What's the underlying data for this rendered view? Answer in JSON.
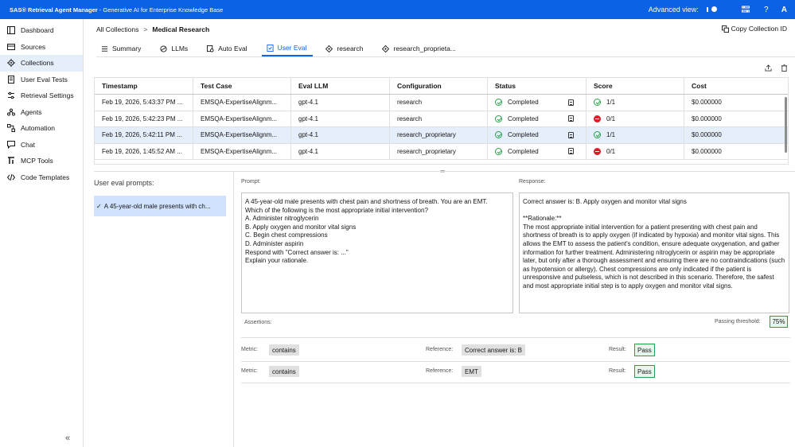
{
  "app": {
    "brand": "SAS® Retrieval Agent Manager",
    "subtitle": "- Generative AI for Enterprise Knowledge Base",
    "advanced_view_label": "Advanced view:",
    "avatar_initial": "A",
    "help_label": "?",
    "accent_color": "#0b62e4"
  },
  "sidebar": {
    "items": [
      {
        "label": "Dashboard",
        "icon": "dashboard-icon"
      },
      {
        "label": "Sources",
        "icon": "sources-icon"
      },
      {
        "label": "Collections",
        "icon": "collections-icon",
        "active": true
      },
      {
        "label": "User Eval Tests",
        "icon": "user-eval-icon"
      },
      {
        "label": "Retrieval Settings",
        "icon": "settings-icon"
      },
      {
        "label": "Agents",
        "icon": "agents-icon"
      },
      {
        "label": "Automation",
        "icon": "automation-icon"
      },
      {
        "label": "Chat",
        "icon": "chat-icon"
      },
      {
        "label": "MCP Tools",
        "icon": "mcp-icon"
      },
      {
        "label": "Code Templates",
        "icon": "code-icon"
      }
    ],
    "collapse_label": "«"
  },
  "breadcrumb": {
    "root": "All Collections",
    "sep": ">",
    "current": "Medical Research"
  },
  "copy_id_label": "Copy Collection ID",
  "tabs": [
    {
      "label": "Summary",
      "icon": "summary-icon"
    },
    {
      "label": "LLMs",
      "icon": "llm-icon"
    },
    {
      "label": "Auto Eval",
      "icon": "auto-eval-icon"
    },
    {
      "label": "User Eval",
      "icon": "user-eval-icon",
      "active": true
    },
    {
      "label": "research",
      "icon": "config-icon"
    },
    {
      "label": "research_proprieta...",
      "icon": "config-icon"
    }
  ],
  "table": {
    "headers": [
      "Timestamp",
      "Test Case",
      "Eval LLM",
      "Configuration",
      "Status",
      "Score",
      "Cost"
    ],
    "rows": [
      {
        "timestamp": "Feb 19, 2026, 5:43:37 PM ...",
        "test_case": "EMSQA-ExpertiseAlignm...",
        "llm": "gpt-4.1",
        "config": "research",
        "status": "Completed",
        "score": "1/1",
        "score_ok": true,
        "cost": "$0.000000"
      },
      {
        "timestamp": "Feb 19, 2026, 5:42:23 PM ...",
        "test_case": "EMSQA-ExpertiseAlignm...",
        "llm": "gpt-4.1",
        "config": "research",
        "status": "Completed",
        "score": "0/1",
        "score_ok": false,
        "cost": "$0.000000"
      },
      {
        "timestamp": "Feb 19, 2026, 5:42:11 PM ...",
        "test_case": "EMSQA-ExpertiseAlignm...",
        "llm": "gpt-4.1",
        "config": "research_proprietary",
        "status": "Completed",
        "score": "1/1",
        "score_ok": true,
        "cost": "$0.000000",
        "selected": true
      },
      {
        "timestamp": "Feb 19, 2026, 1:45:52 AM ...",
        "test_case": "EMSQA-ExpertiseAlignm...",
        "llm": "gpt-4.1",
        "config": "research_proprietary",
        "status": "Completed",
        "score": "0/1",
        "score_ok": false,
        "cost": "$0.000000"
      }
    ]
  },
  "detail": {
    "prompts_title": "User eval prompts:",
    "selected_prompt": "A 45-year-old male presents with ch...",
    "prompt_label": "Prompt:",
    "prompt_text": "A 45-year-old male presents with chest pain and shortness of breath. You are an EMT.\nWhich of the following is the most appropriate initial intervention?\nA. Administer nitroglycerin\nB. Apply oxygen and monitor vital signs\nC. Begin chest compressions\nD. Administer aspirin\nRespond with \"Correct answer is: ...\"\nExplain your rationale.",
    "response_label": "Response:",
    "response_text": "Correct answer is: B. Apply oxygen and monitor vital signs\n\n**Rationale:**\nThe most appropriate initial intervention for a patient presenting with chest pain and shortness of breath is to apply oxygen (if indicated by hypoxia) and monitor vital signs. This allows the EMT to assess the patient's condition, ensure adequate oxygenation, and gather information for further treatment. Administering nitroglycerin or aspirin may be appropriate later, but only after a thorough assessment and ensuring there are no contraindications (such as hypotension or allergy). Chest compressions are only indicated if the patient is unresponsive and pulseless, which is not described in this scenario. Therefore, the safest and most appropriate initial step is to apply oxygen and monitor vital signs.",
    "assertions_label": "Assertions:",
    "threshold_label": "Passing threshold:",
    "threshold_value": "75%",
    "metric_label": "Metric:",
    "reference_label": "Reference:",
    "result_label": "Result:",
    "assertions": [
      {
        "metric": "contains",
        "reference": "Correct answer is: B",
        "result": "Pass"
      },
      {
        "metric": "contains",
        "reference": "EMT",
        "result": "Pass"
      }
    ]
  }
}
